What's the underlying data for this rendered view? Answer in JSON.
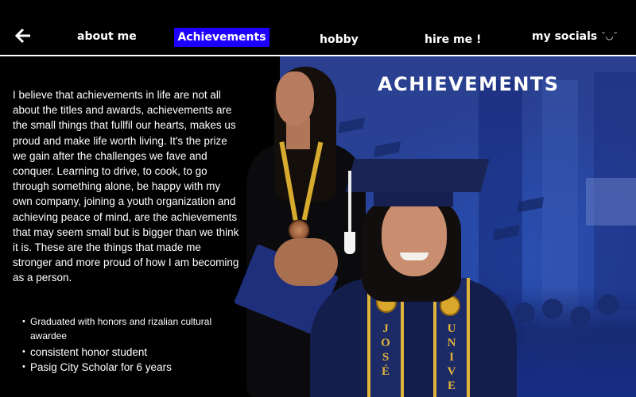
{
  "nav": {
    "about": "about me",
    "achievements": "Achievements",
    "hobby": "hobby",
    "hire": "hire me !",
    "socials": "my socials",
    "socials_face": "˘◡˘"
  },
  "section": {
    "title": "ACHIEVEMENTS",
    "paragraph": "I believe that achievements in life are not all about the titles and awards, achievements are the small things that fullfil our hearts, makes us proud and make life worth living. It's the prize we gain after the challenges we fave and conquer. Learning to drive, to cook, to go through something alone, be happy with my own company, joining a youth organization and achieving peace of mind, are the achievements that may seem small but is bigger than we think it is. These are the things that made me stronger and more proud of how I am becoming as a person.",
    "bullets": [
      "Graduated with honors and rizalian cultural awardee",
      "consistent honor student",
      "Pasig City Scholar for 6 years"
    ]
  },
  "photo": {
    "stole_left_text": "JOSÉ",
    "stole_right_text": "UNIVE"
  },
  "colors": {
    "accent": "#1e00ff",
    "background": "#000000",
    "photo_blue": "#27429a",
    "gold": "#e0b43a"
  },
  "icons": {
    "back": "arrow-left-icon"
  }
}
